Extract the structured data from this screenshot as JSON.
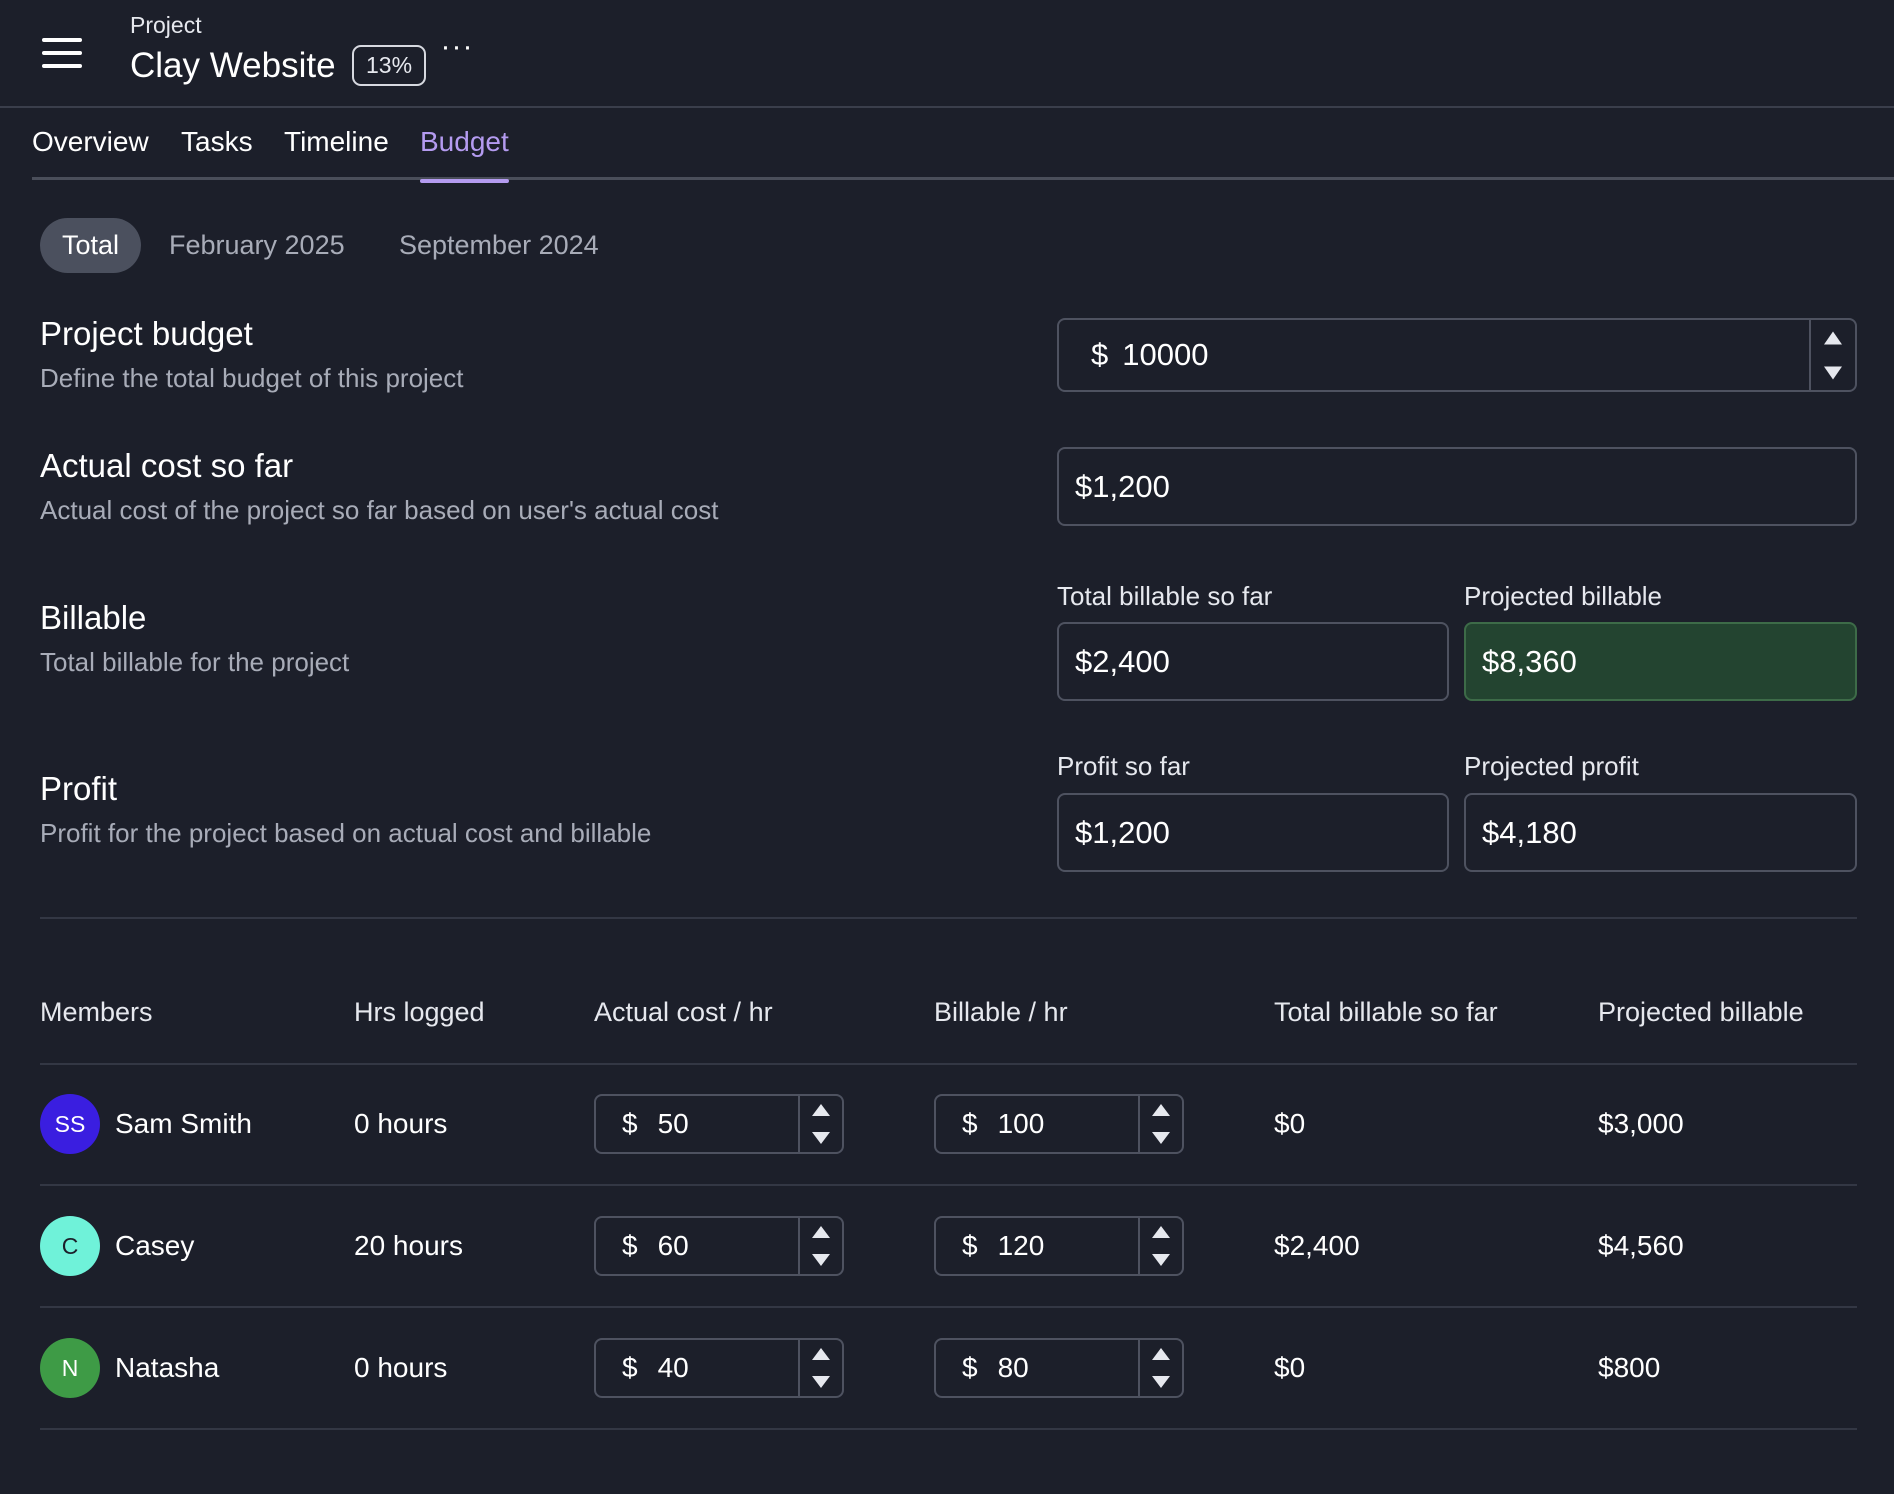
{
  "header": {
    "eyebrow": "Project",
    "title": "Clay Website",
    "percent": "13%",
    "more": "···"
  },
  "tabs": [
    {
      "label": "Overview",
      "active": false
    },
    {
      "label": "Tasks",
      "active": false
    },
    {
      "label": "Timeline",
      "active": false
    },
    {
      "label": "Budget",
      "active": true
    }
  ],
  "periods": [
    {
      "label": "Total",
      "active": true
    },
    {
      "label": "February 2025",
      "active": false
    },
    {
      "label": "September 2024",
      "active": false
    }
  ],
  "project_budget": {
    "title": "Project budget",
    "description": "Define the total budget of this project",
    "currency": "$",
    "value": "10000"
  },
  "actual_cost": {
    "title": "Actual cost so far",
    "description": "Actual cost of the project so far based on user's actual cost",
    "value": "$1,200"
  },
  "billable": {
    "title": "Billable",
    "description": "Total billable for the project",
    "so_far_label": "Total billable so far",
    "so_far_value": "$2,400",
    "projected_label": "Projected billable",
    "projected_value": "$8,360"
  },
  "profit": {
    "title": "Profit",
    "description": "Profit for the project based on actual cost and billable",
    "so_far_label": "Profit so far",
    "so_far_value": "$1,200",
    "projected_label": "Projected profit",
    "projected_value": "$4,180"
  },
  "members_table": {
    "columns": [
      "Members",
      "Hrs logged",
      "Actual cost / hr",
      "Billable / hr",
      "Total billable so far",
      "Projected billable"
    ],
    "currency": "$",
    "rows": [
      {
        "initials": "SS",
        "avatar_color": "#3a1ee0",
        "name": "Sam Smith",
        "hours": "0 hours",
        "cost": "50",
        "billable": "100",
        "total_billable": "$0",
        "projected": "$3,000"
      },
      {
        "initials": "C",
        "avatar_color": "#6ff2d9",
        "name": "Casey",
        "hours": "20 hours",
        "cost": "60",
        "billable": "120",
        "total_billable": "$2,400",
        "projected": "$4,560"
      },
      {
        "initials": "N",
        "avatar_color": "#3e9b46",
        "name": "Natasha",
        "hours": "0 hours",
        "cost": "40",
        "billable": "80",
        "total_billable": "$0",
        "projected": "$800"
      }
    ]
  },
  "colors": {
    "background": "#1c1f2a",
    "accent": "#b49bf0",
    "projected_billable_bg": "#234430"
  }
}
